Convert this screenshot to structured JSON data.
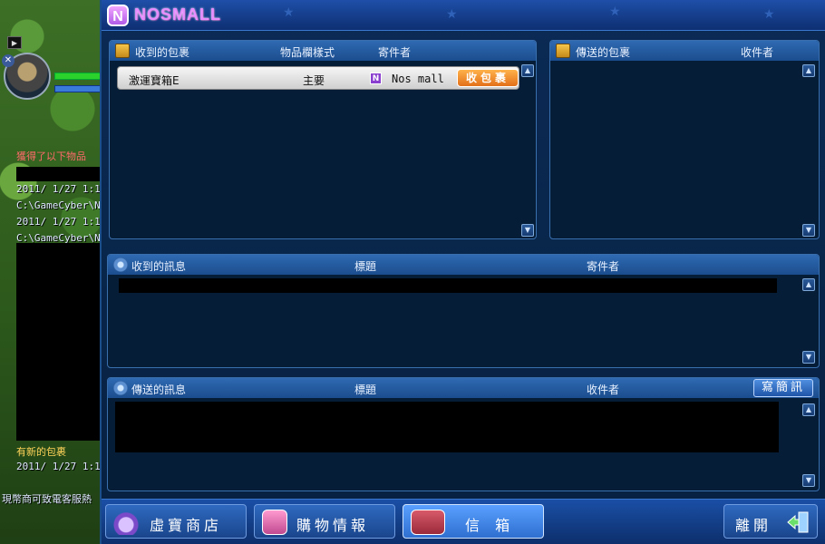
{
  "game": {
    "line_red": "獲得了以下物品",
    "log1": "2011/ 1/27  1:1",
    "log2": "C:\\GameCyber\\No",
    "log3": "2011/ 1/27  1:1",
    "log4": "C:\\GameCyber\\No",
    "line_new_package": "有新的包裹",
    "log5": "2011/ 1/27  1:1",
    "line_bottom": "現幣商可致電客服熱"
  },
  "window": {
    "logo_badge": "N",
    "title": "NOSMALL"
  },
  "received_packages": {
    "title": "收到的包裹",
    "col_item": "物品欄樣式",
    "col_sender": "寄件者",
    "rows": [
      {
        "name": "激運寶箱E",
        "slot": "主要",
        "sender_badge": "N",
        "sender": "Nos mall",
        "action": "收包裹"
      }
    ]
  },
  "sent_packages": {
    "title": "傳送的包裹",
    "col_recipient": "收件者"
  },
  "received_messages": {
    "title": "收到的訊息",
    "col_subject": "標題",
    "col_sender": "寄件者"
  },
  "sent_messages": {
    "title": "傳送的訊息",
    "col_subject": "標題",
    "col_recipient": "收件者",
    "write_button": "寫簡訊"
  },
  "bottom_nav": {
    "shop": "虛寶商店",
    "shopping_info": "購物情報",
    "mailbox": "信 箱",
    "exit": "離開"
  },
  "colors": {
    "accent_orange": "#e3701a",
    "brand_purple": "#e98cff",
    "panel_blue": "#2f6ab2"
  },
  "icons": {
    "package": "package-icon",
    "message": "message-arrows-icon",
    "scroll_up": "chevron-up-icon",
    "scroll_down": "chevron-down-icon"
  }
}
